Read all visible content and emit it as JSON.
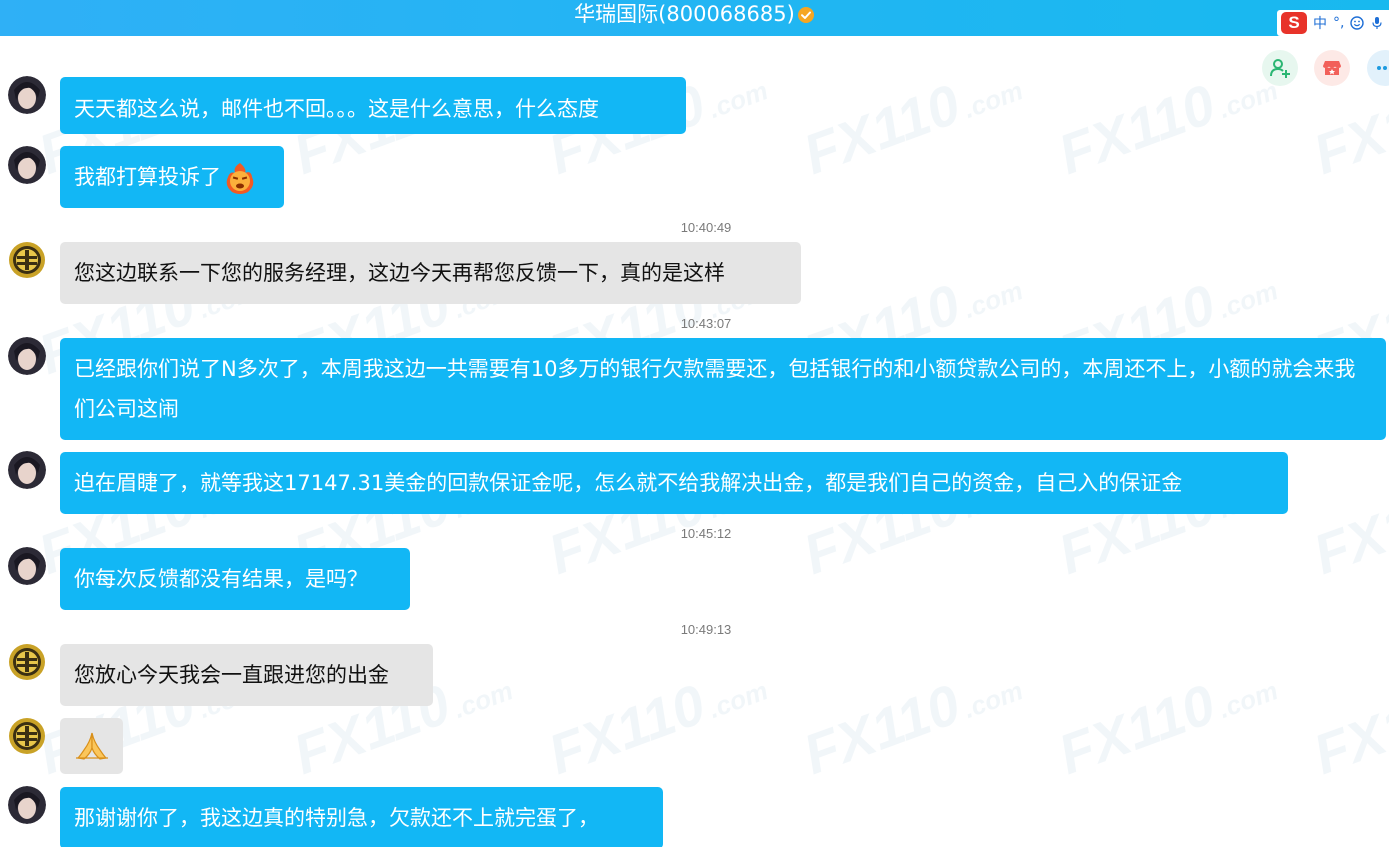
{
  "window": {
    "title": "华瑞国际(800068685)",
    "verified_icon": "verified-badge-icon",
    "accent_color": "#22b5f3"
  },
  "ime": {
    "logo": "S",
    "mode": "中",
    "punct": "°,",
    "icons": [
      "smiley-icon",
      "microphone-icon"
    ]
  },
  "actions": {
    "icons": [
      "add-user-icon",
      "shop-icon",
      "more-icon"
    ]
  },
  "watermark": {
    "big": "FX110",
    "small": ".com"
  },
  "colors": {
    "user_bubble": "#12b7f5",
    "service_bubble": "#e5e5e5"
  },
  "messages": [
    {
      "type": "user",
      "text": "天天都这么说，邮件也不回。。。这是什么意思，什么态度"
    },
    {
      "type": "user",
      "text": "我都打算投诉了",
      "emoji": "angry-fire-emoji"
    },
    {
      "type": "timestamp",
      "text": "10:40:49"
    },
    {
      "type": "service",
      "text": "您这边联系一下您的服务经理，这边今天再帮您反馈一下，真的是这样"
    },
    {
      "type": "timestamp",
      "text": "10:43:07"
    },
    {
      "type": "user",
      "text": "已经跟你们说了N多次了，本周我这边一共需要有10多万的银行欠款需要还，包括银行的和小额贷款公司的，本周还不上，小额的就会来我们公司这闹"
    },
    {
      "type": "user",
      "text": "迫在眉睫了，就等我这17147.31美金的回款保证金呢，怎么就不给我解决出金，都是我们自己的资金，自己入的保证金"
    },
    {
      "type": "timestamp",
      "text": "10:45:12"
    },
    {
      "type": "user",
      "text": "你每次反馈都没有结果，是吗？"
    },
    {
      "type": "timestamp",
      "text": "10:49:13"
    },
    {
      "type": "service",
      "text": "您放心今天我会一直跟进您的出金"
    },
    {
      "type": "service",
      "text": "",
      "emoji": "praying-hands-emoji"
    },
    {
      "type": "user",
      "text": "那谢谢你了，我这边真的特别急，欠款还不上就完蛋了，"
    }
  ]
}
